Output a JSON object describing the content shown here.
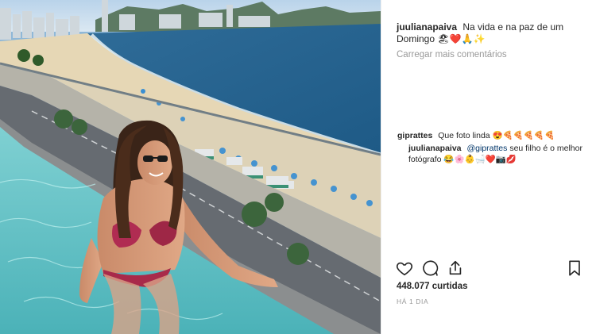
{
  "post": {
    "username": "juulianapaiva",
    "caption_text": "Na vida e na paz de um Domingo",
    "caption_emojis": "🏖❤️🙏✨",
    "load_more_label": "Carregar mais comentários",
    "comments": [
      {
        "username": "giprattes",
        "text": "Que foto linda",
        "emojis": "😍🍕🍕🍕🍕🍕"
      }
    ],
    "reply": {
      "username": "juulianapaiva",
      "mention": "@giprattes",
      "text": "seu filho é o melhor fotógrafo",
      "emojis": "😂🌸👶🛁❤️📷💋"
    },
    "likes_label": "448.077 curtidas",
    "time_label": "HÁ 1 DIA"
  },
  "icons": {
    "like": "heart-icon",
    "comment": "comment-icon",
    "share": "share-icon",
    "save": "bookmark-icon"
  }
}
